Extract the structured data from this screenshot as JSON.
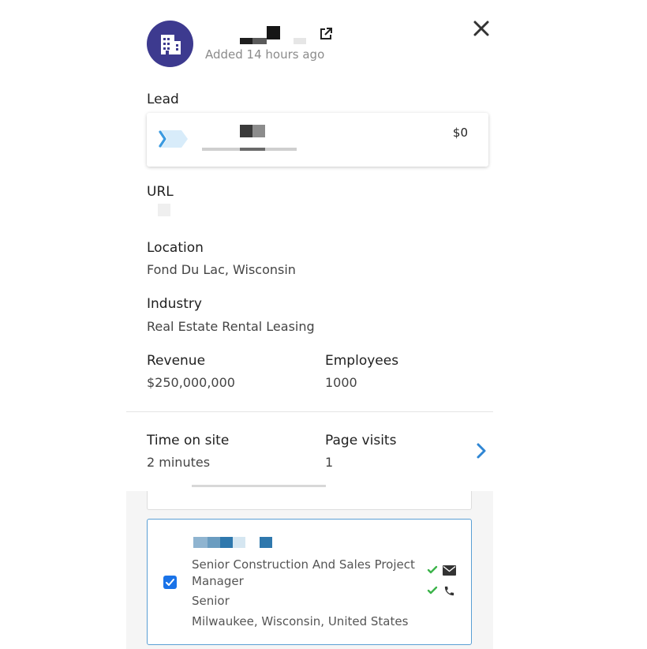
{
  "header": {
    "added_text": "Added 14 hours ago"
  },
  "lead": {
    "label": "Lead",
    "amount": "$0"
  },
  "url": {
    "label": "URL"
  },
  "location": {
    "label": "Location",
    "value": "Fond Du Lac, Wisconsin"
  },
  "industry": {
    "label": "Industry",
    "value": "Real Estate Rental Leasing"
  },
  "revenue": {
    "label": "Revenue",
    "value": "$250,000,000"
  },
  "employees": {
    "label": "Employees",
    "value": "1000"
  },
  "time_on_site": {
    "label": "Time on site",
    "value": "2 minutes"
  },
  "page_visits": {
    "label": "Page visits",
    "value": "1"
  },
  "contact": {
    "title": "Senior Construction And Sales Project Manager",
    "seniority": "Senior",
    "location": "Milwaukee, Wisconsin, United States",
    "selected": true
  },
  "colors": {
    "avatar_bg": "#3d3a8f",
    "accent_blue": "#1a73e8",
    "check_green": "#3cb34a",
    "chevron_blue": "#2f86d4"
  }
}
